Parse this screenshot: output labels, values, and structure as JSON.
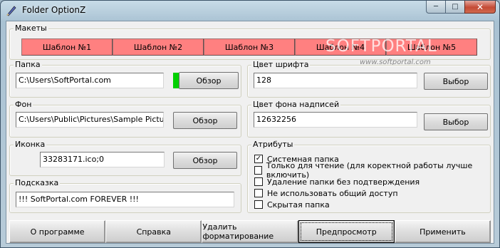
{
  "window": {
    "title": "Folder OptionZ",
    "caption_buttons": {
      "minimize": "─",
      "maximize": "□",
      "close": "✕"
    }
  },
  "templates": {
    "legend": "Макеты",
    "items": [
      "Шаблон №1",
      "Шаблон №2",
      "Шаблон №3",
      "Шаблон №4",
      "Шаблон №5"
    ]
  },
  "watermark": {
    "logo": "SOFTPORTAL",
    "url": "www.softportal.com"
  },
  "folder": {
    "legend": "Папка",
    "value": "C:\\Users\\SoftPortal.com",
    "browse": "Обзор"
  },
  "background": {
    "legend": "Фон",
    "value": "C:\\Users\\Public\\Pictures\\Sample Pictures\\",
    "browse": "Обзор"
  },
  "icon": {
    "legend": "Иконка",
    "value": "33283171.ico;0",
    "browse": "Обзор"
  },
  "tooltip": {
    "legend": "Подсказка",
    "value": "!!! SoftPortal.com FOREVER !!!"
  },
  "font_color": {
    "legend": "Цвет шрифта",
    "value": "128",
    "choose": "Выбор"
  },
  "label_bg_color": {
    "legend": "Цвет фона надписей",
    "value": "12632256",
    "choose": "Выбор"
  },
  "attributes": {
    "legend": "Атрибуты",
    "items": [
      {
        "label": "Системная папка",
        "checked": true
      },
      {
        "label": "Только для чтение (для коректной работы лучше включить)",
        "checked": false
      },
      {
        "label": "Удаление папки без подтверждения",
        "checked": false
      },
      {
        "label": "Не использовать общий доступ",
        "checked": false
      },
      {
        "label": "Скрытая папка",
        "checked": false
      }
    ]
  },
  "bottom_buttons": {
    "about": "О программе",
    "help": "Справка",
    "remove_formatting": "Удалить форматирование",
    "preview": "Предпросмотр",
    "apply": "Применить"
  },
  "colors": {
    "template_button": "#ff8080",
    "indicator": "#00d000"
  }
}
